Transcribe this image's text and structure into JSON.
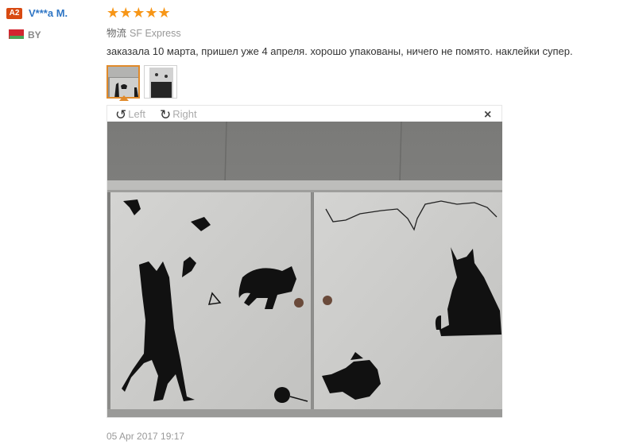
{
  "reviewer": {
    "level_badge": "A2",
    "name": "V***a M.",
    "country_code": "BY"
  },
  "rating": {
    "stars": 5,
    "stars_text": "★★★★★"
  },
  "shipping": {
    "label": "物流",
    "carrier": "SF Express"
  },
  "review_text": "заказала 10 марта, пришел уже 4 апреля. хорошо упакованы, ничего не помято. наклейки супер.",
  "viewer": {
    "rotate_left_label": "Left",
    "rotate_right_label": "Right",
    "close_label": "×",
    "rotate_left_icon": "rotate-left-icon",
    "rotate_right_icon": "rotate-right-icon"
  },
  "thumbnails": [
    {
      "name": "cat-stickers-photo-1",
      "selected": true
    },
    {
      "name": "cat-stickers-photo-2",
      "selected": false
    }
  ],
  "review_date": "05 Apr 2017 19:17",
  "colors": {
    "star": "#f79617",
    "name_link": "#2f76c5",
    "level_badge": "#d84a12",
    "selected_border": "#e08a2a"
  }
}
